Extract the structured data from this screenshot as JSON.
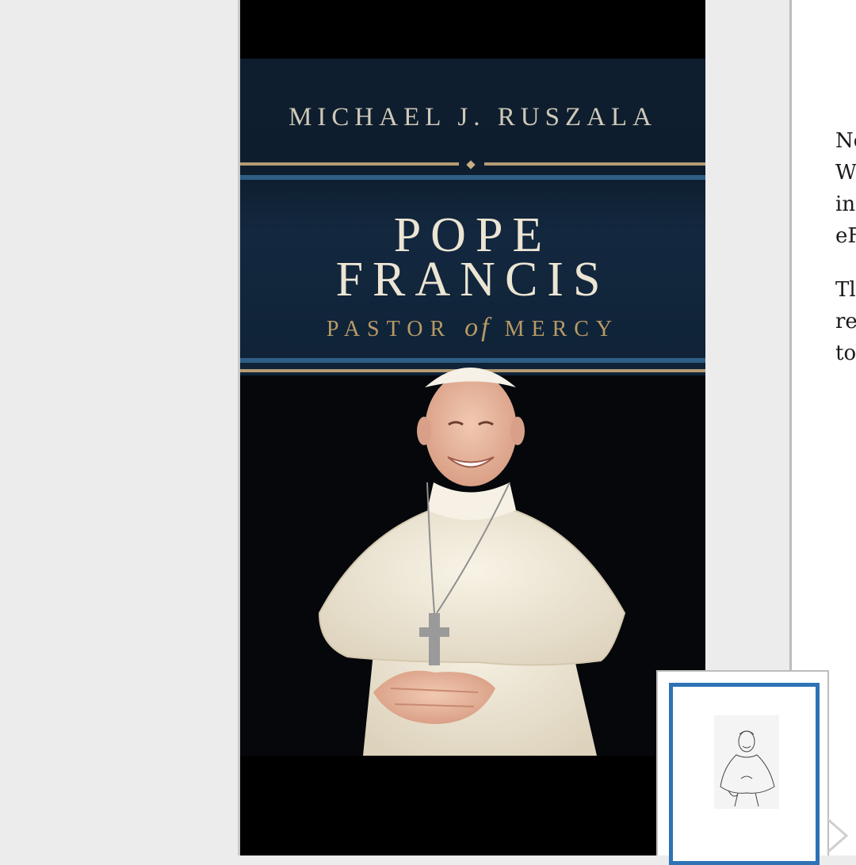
{
  "cover": {
    "author": "MICHAEL J. RUSZALA",
    "title_line1": "POPE",
    "title_line2": "FRANCIS",
    "subtitle_pre": "PASTOR",
    "subtitle_of": "of",
    "subtitle_post": "MERCY"
  },
  "right_page": {
    "paragraphs": [
      [
        "Ne",
        "W",
        "in",
        "eF"
      ],
      [
        "Tl",
        "re",
        "to"
      ]
    ]
  },
  "thumbnail": {
    "icon": "chevron-right-icon"
  },
  "colors": {
    "accent": "#2d73b5",
    "cover_gold": "#b69b74",
    "cover_blue": "#2f5e85"
  }
}
